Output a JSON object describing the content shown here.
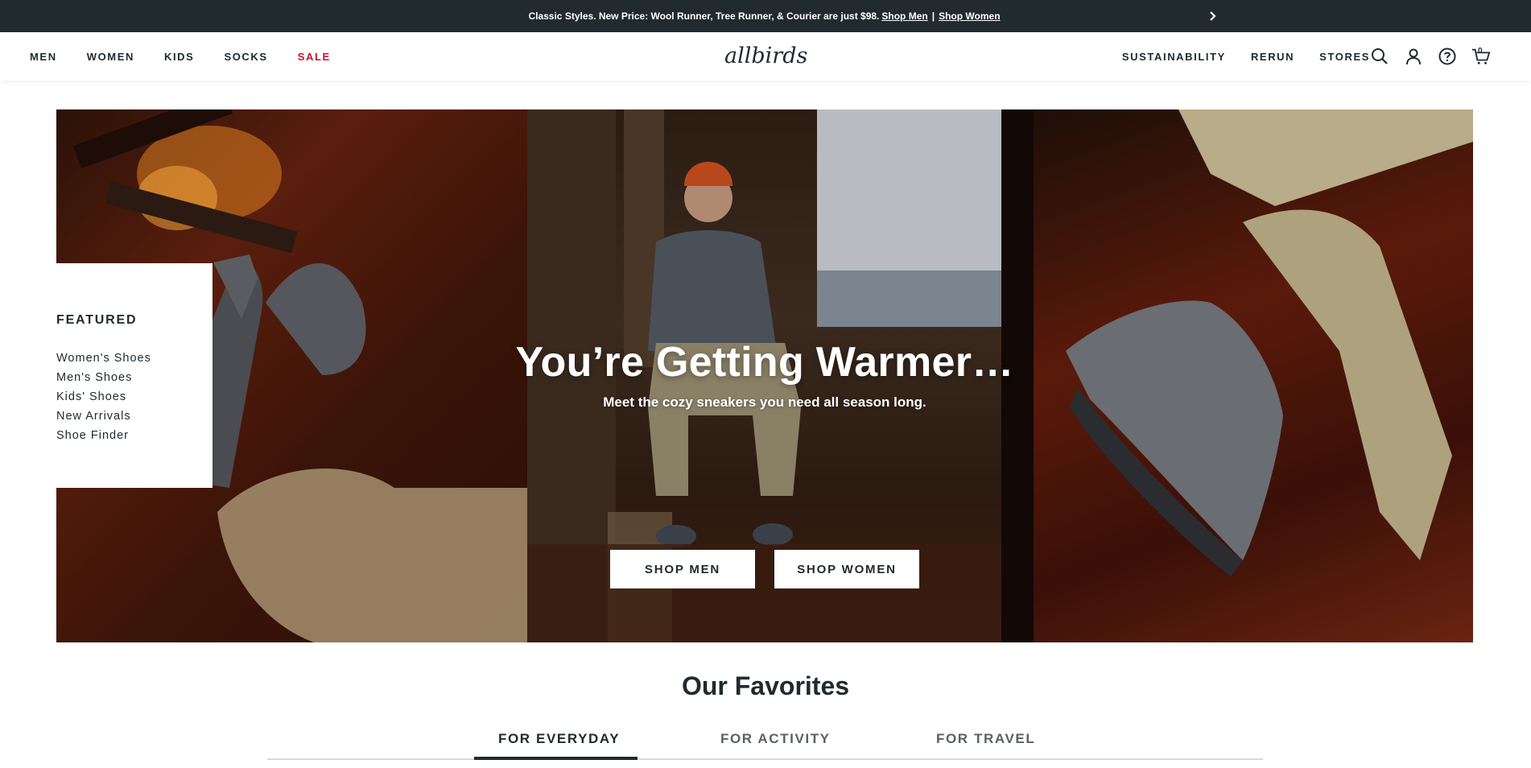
{
  "announcement": {
    "text": "Classic Styles. New Price: Wool Runner, Tree Runner, & Courier are just $98.",
    "link_men": "Shop Men",
    "separator": "|",
    "link_women": "Shop Women",
    "next_icon": "chevron-right-icon"
  },
  "nav": {
    "left": [
      "MEN",
      "WOMEN",
      "KIDS",
      "SOCKS",
      "SALE"
    ],
    "logo": "allbirds",
    "right": [
      "SUSTAINABILITY",
      "RERUN",
      "STORES"
    ],
    "icons": [
      "search-icon",
      "account-icon",
      "help-icon",
      "cart-icon"
    ],
    "cart_count": "0"
  },
  "hero": {
    "title": "You’re Getting Warmer…",
    "subtitle": "Meet the cozy sneakers you need all season long.",
    "btn_men": "SHOP MEN",
    "btn_women": "SHOP WOMEN"
  },
  "featured": {
    "title": "FEATURED",
    "links": [
      "Women's Shoes",
      "Men's Shoes",
      "Kids' Shoes",
      "New Arrivals",
      "Shoe Finder"
    ]
  },
  "favorites": {
    "title": "Our Favorites",
    "tabs": [
      "FOR EVERYDAY",
      "FOR ACTIVITY",
      "FOR TRAVEL"
    ],
    "active_tab": "FOR EVERYDAY"
  },
  "colors": {
    "dark": "#212a2f",
    "sale": "#c8102e"
  }
}
